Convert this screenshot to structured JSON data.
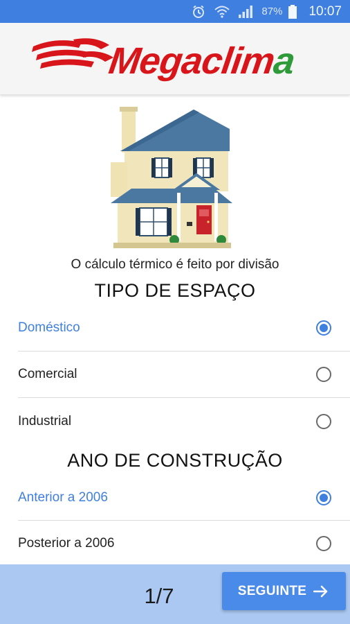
{
  "status_bar": {
    "battery_percent": "87%",
    "time": "10:07",
    "icons": [
      "alarm-icon",
      "wifi-icon",
      "signal-icon",
      "battery-icon"
    ]
  },
  "header": {
    "logo_text_main": "Megaclim",
    "logo_text_tail": "a",
    "brand_colors": {
      "red": "#d8151b",
      "green": "#2f9a3a"
    }
  },
  "main": {
    "illustration": "house-illustration",
    "subtitle": "O cálculo térmico é feito por divisão",
    "space_type": {
      "title": "TIPO DE ESPAÇO",
      "options": [
        {
          "label": "Doméstico",
          "selected": true
        },
        {
          "label": "Comercial",
          "selected": false
        },
        {
          "label": "Industrial",
          "selected": false
        }
      ]
    },
    "construction_year": {
      "title": "ANO DE CONSTRUÇÃO",
      "options": [
        {
          "label": "Anterior a 2006",
          "selected": true
        },
        {
          "label": "Posterior a 2006",
          "selected": false
        }
      ]
    }
  },
  "footer": {
    "page_indicator": "1/7",
    "next_label": "SEGUINTE"
  },
  "colors": {
    "accent": "#3f7fe0",
    "footer_bg": "#aac8f2",
    "button": "#4a8ae8"
  }
}
